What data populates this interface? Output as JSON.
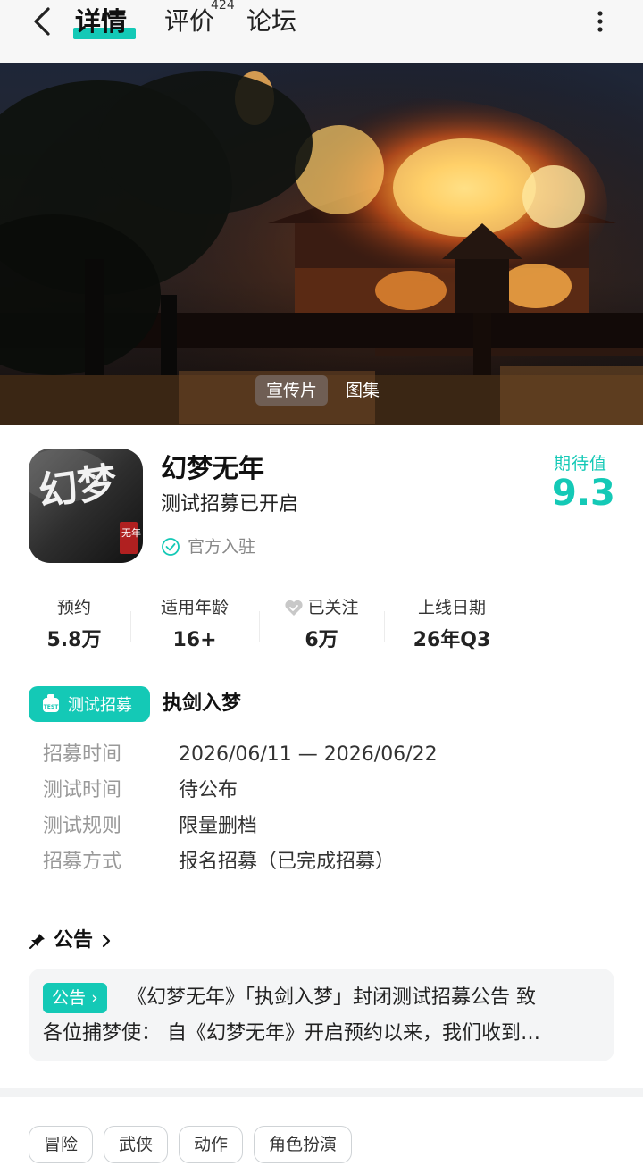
{
  "nav": {
    "tabs": [
      {
        "label": "详情"
      },
      {
        "label": "评价",
        "count": "424"
      },
      {
        "label": "论坛"
      }
    ]
  },
  "hero": {
    "tabs": [
      "宣传片",
      "图集"
    ]
  },
  "game": {
    "title": "幻梦无年",
    "subtitle": "测试招募已开启",
    "official": "官方入驻",
    "expect_label": "期待值",
    "expect_value": "9.3",
    "icon_text": {
      "big": "幻梦",
      "small": "无年"
    }
  },
  "stats": [
    {
      "label": "预约",
      "value": "5.8万"
    },
    {
      "label": "适用年龄",
      "value": "16+"
    },
    {
      "label": "已关注",
      "value": "6万"
    },
    {
      "label": "上线日期",
      "value": "26年Q3"
    }
  ],
  "recruit": {
    "badge": "测试招募",
    "badge_icon_text": "TEST",
    "title": "执剑入梦",
    "rows": [
      {
        "key": "招募时间",
        "value": "2026/06/11 — 2026/06/22"
      },
      {
        "key": "测试时间",
        "value": "待公布"
      },
      {
        "key": "测试规则",
        "value": "限量删档"
      },
      {
        "key": "招募方式",
        "value": "报名招募（已完成招募）"
      }
    ]
  },
  "notice": {
    "heading": "公告",
    "tag": "公告",
    "line1": "《幻梦无年》「执剑入梦」封闭测试招募公告 致",
    "line2": "各位捕梦使：  自《幻梦无年》开启预约以来，我们收到…"
  },
  "tags": [
    "冒险",
    "武侠",
    "动作",
    "角色扮演"
  ],
  "colors": {
    "accent": "#14c9b6",
    "muted": "#999999",
    "notice_bg": "#f4f5f6"
  }
}
